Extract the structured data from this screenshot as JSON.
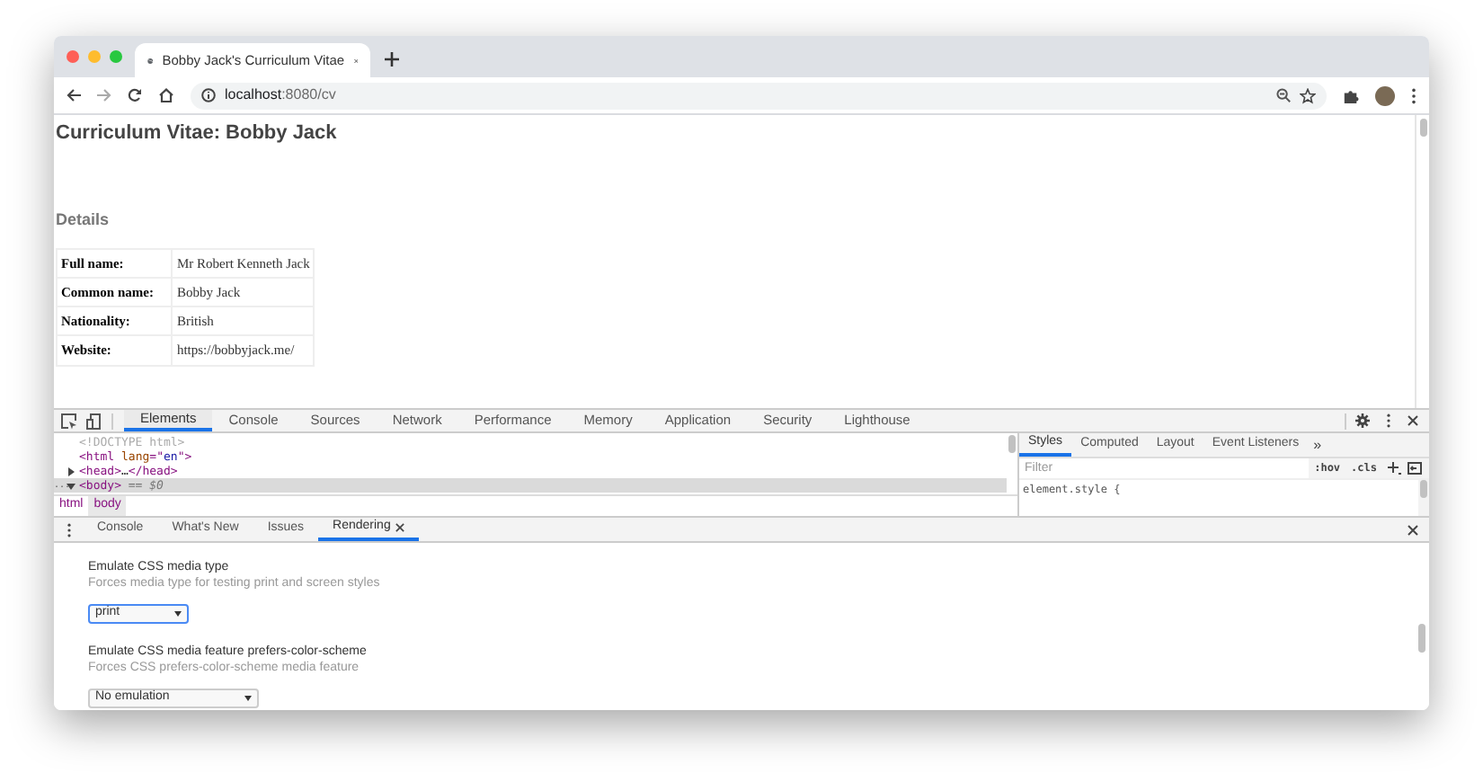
{
  "browser": {
    "tab_title": "Bobby Jack's Curriculum Vitae",
    "url_host": "localhost",
    "url_path": ":8080/cv"
  },
  "page": {
    "heading": "Curriculum Vitae: Bobby Jack",
    "section": "Details",
    "rows": [
      {
        "label": "Full name:",
        "value": "Mr Robert Kenneth Jack"
      },
      {
        "label": "Common name:",
        "value": "Bobby Jack"
      },
      {
        "label": "Nationality:",
        "value": "British"
      },
      {
        "label": "Website:",
        "value": "https://bobbyjack.me/"
      }
    ]
  },
  "devtools": {
    "tabs": [
      {
        "label": "Elements",
        "selected": true
      },
      {
        "label": "Console",
        "selected": false
      },
      {
        "label": "Sources",
        "selected": false
      },
      {
        "label": "Network",
        "selected": false
      },
      {
        "label": "Performance",
        "selected": false
      },
      {
        "label": "Memory",
        "selected": false
      },
      {
        "label": "Application",
        "selected": false
      },
      {
        "label": "Security",
        "selected": false
      },
      {
        "label": "Lighthouse",
        "selected": false
      }
    ],
    "dom_lines": [
      {
        "kind": "doctype",
        "selected": false,
        "parts": [
          {
            "kind": "comment",
            "text": "<!DOCTYPE html>"
          }
        ]
      },
      {
        "kind": "plain",
        "selected": false,
        "parts": [
          {
            "kind": "tag",
            "text": "<html"
          },
          {
            "kind": "attr",
            "text": " lang"
          },
          {
            "kind": "tag",
            "text": "=\""
          },
          {
            "kind": "value",
            "text": "en"
          },
          {
            "kind": "tag",
            "text": "\">"
          }
        ]
      },
      {
        "kind": "collapsed",
        "selected": false,
        "parts": [
          {
            "kind": "tag",
            "text": "<head>"
          },
          {
            "kind": "plain",
            "text": "…"
          },
          {
            "kind": "tag",
            "text": "</head>"
          }
        ]
      },
      {
        "kind": "expanded",
        "selected": true,
        "gutter": "...",
        "parts": [
          {
            "kind": "tag",
            "text": "<body>"
          },
          {
            "kind": "note",
            "text": " == $0"
          }
        ]
      }
    ],
    "breadcrumbs": [
      {
        "label": "html",
        "selected": false
      },
      {
        "label": "body",
        "selected": true
      }
    ],
    "styles_tabs": [
      {
        "label": "Styles",
        "selected": true
      },
      {
        "label": "Computed",
        "selected": false
      },
      {
        "label": "Layout",
        "selected": false
      },
      {
        "label": "Event Listeners",
        "selected": false
      }
    ],
    "styles_more": "»",
    "filter_placeholder": "Filter",
    "hov": ":hov",
    "cls": ".cls",
    "element_style": "element.style {",
    "drawer_tabs": [
      {
        "label": "Console",
        "selected": false,
        "closable": false
      },
      {
        "label": "What's New",
        "selected": false,
        "closable": false
      },
      {
        "label": "Issues",
        "selected": false,
        "closable": false
      },
      {
        "label": "Rendering",
        "selected": true,
        "closable": true
      }
    ],
    "settings": [
      {
        "title": "Emulate CSS media type",
        "description": "Forces media type for testing print and screen styles",
        "value": "print",
        "focused": true
      },
      {
        "title": "Emulate CSS media feature prefers-color-scheme",
        "description": "Forces CSS prefers-color-scheme media feature",
        "value": "No emulation",
        "focused": false
      }
    ]
  }
}
